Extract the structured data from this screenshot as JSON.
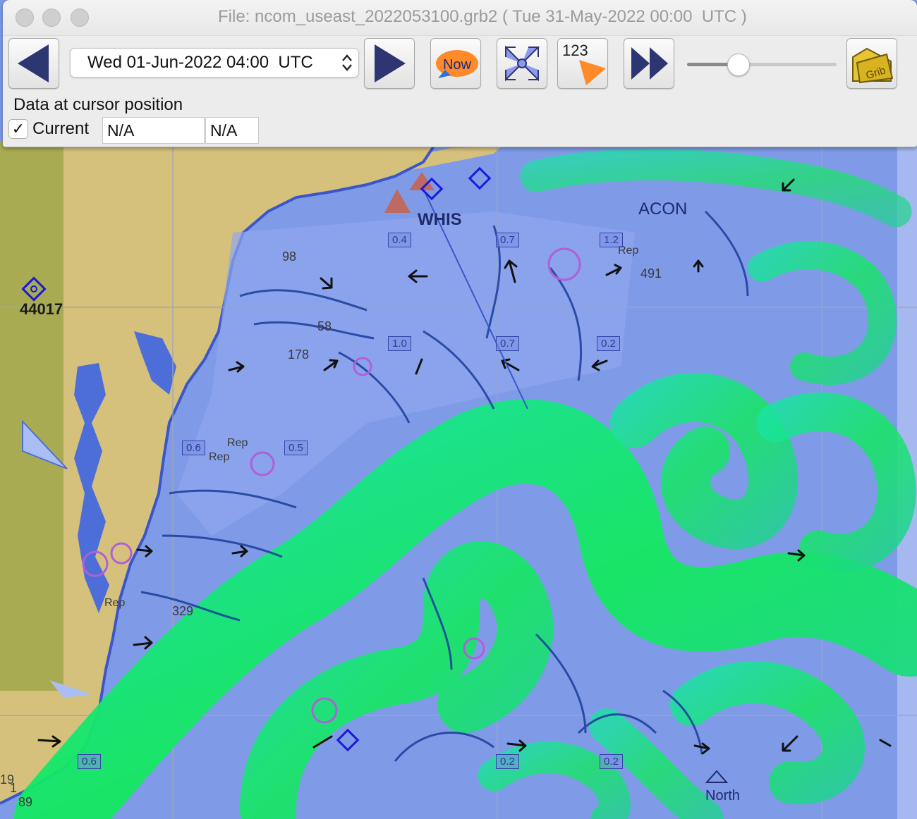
{
  "window": {
    "title": "File: ncom_useast_2022053100.grb2 ( Tue 31-May-2022 00:00  UTC )"
  },
  "toolbar": {
    "time_select_value": "Wed 01-Jun-2022 04:00  UTC",
    "now_button_label": "Now",
    "numbers_button_label": "123",
    "grib_folder_label": "Grib",
    "slider_value_fraction": 0.34
  },
  "data_panel": {
    "heading": "Data at cursor position",
    "current_label": "Current",
    "current_checked": "✓",
    "value_1": "N/A",
    "value_2": "N/A"
  },
  "map": {
    "buoy_label": "44017",
    "beacon_label": "ACON",
    "north_label": "North",
    "whis_label": "WHIS",
    "depth_labels": [
      "98",
      "491",
      "329",
      "58",
      "178",
      "89",
      "19",
      "1",
      "Rep",
      "Rep",
      "Rep",
      "Rep"
    ],
    "current_values": [
      "0.4",
      "0.7",
      "1.2",
      "1.0",
      "0.7",
      "0.2",
      "0.5",
      "0.6",
      "0.2",
      "0.6",
      "0.2"
    ]
  },
  "colors": {
    "land": "#d6c17c",
    "sea": "#7f9be8",
    "current_strong": "#14e860",
    "current_weak": "#1a3c9a",
    "arrow": "#111111"
  }
}
